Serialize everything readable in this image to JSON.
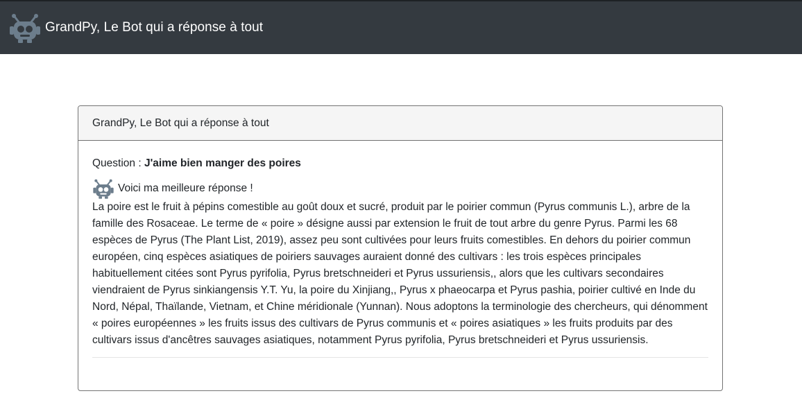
{
  "navbar": {
    "title": "GrandPy, Le Bot qui a réponse à tout",
    "logo_icon": "robot-icon"
  },
  "card": {
    "header": "GrandPy, Le Bot qui a réponse à tout",
    "question_label": "Question : ",
    "question_text": "J'aime bien manger des poires",
    "answer_intro": "Voici ma meilleure réponse !",
    "answer_icon": "robot-icon",
    "answer_text": "La poire est le fruit à pépins comestible au goût doux et sucré, produit par le poirier commun (Pyrus communis L.), arbre de la famille des Rosaceae. Le terme de « poire » désigne aussi par extension le fruit de tout arbre du genre Pyrus. Parmi les 68 espèces de Pyrus (The Plant List, 2019), assez peu sont cultivées pour leurs fruits comestibles. En dehors du poirier commun européen, cinq espèces asiatiques de poiriers sauvages auraient donné des cultivars : les trois espèces principales habituellement citées sont Pyrus pyrifolia, Pyrus bretschneideri et Pyrus ussuriensis,, alors que les cultivars secondaires viendraient de Pyrus sinkiangensis Y.T. Yu, la poire du Xinjiang,, Pyrus x phaeocarpa et Pyrus pashia, poirier cultivé en Inde du Nord, Népal, Thaïlande, Vietnam, et Chine méridionale (Yunnan). Nous adoptons la terminologie des chercheurs, qui dénomment « poires européennes » les fruits issus des cultivars de Pyrus communis et « poires asiatiques » les fruits produits par des cultivars issus d'ancêtres sauvages asiatiques, notamment Pyrus pyrifolia, Pyrus bretschneideri et Pyrus ussuriensis."
  },
  "colors": {
    "navbar_bg": "#343a40",
    "robot": "#6c7d8c",
    "card_header_bg": "#f5f5f5"
  }
}
